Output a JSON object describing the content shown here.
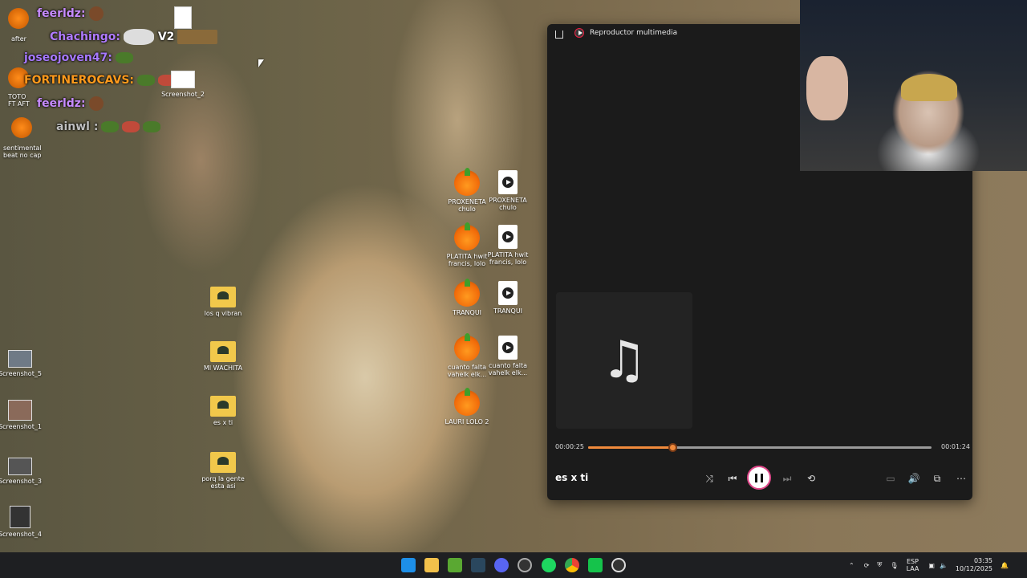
{
  "chat": [
    {
      "user": "feerldz",
      "color": "#c78bff",
      "suffix": ":"
    },
    {
      "user": "Chachingo",
      "color": "#b07bff",
      "suffix": ":",
      "extra": "V2"
    },
    {
      "user": "joseojoven47",
      "color": "#a779ff",
      "suffix": ":"
    },
    {
      "user": "FORTINEROCAVS",
      "color": "#ff9a1c",
      "suffix": ":"
    },
    {
      "user": "feerldz",
      "color": "#c78bff",
      "suffix": ":"
    },
    {
      "user": "ainwl",
      "color": "#bfbfbf",
      "suffix": ":"
    }
  ],
  "chat_side_labels": {
    "after": "after",
    "toto": "TOTO FT AFT",
    "sentimental": "sentimental beat no cap"
  },
  "left_column_icons": [
    {
      "label": "Screenshot_5"
    },
    {
      "label": "Screenshot_1"
    },
    {
      "label": "Screenshot_3"
    },
    {
      "label": "Screenshot_4"
    }
  ],
  "top_icons": [
    {
      "label": ""
    },
    {
      "label": "Screenshot_2"
    }
  ],
  "folder_icons": [
    {
      "label": "los q vibran"
    },
    {
      "label": "MI WACHITA"
    },
    {
      "label": "es x ti"
    },
    {
      "label": "porq la gente esta asi"
    }
  ],
  "project_icons": [
    {
      "fl": "PROXENETA chulo",
      "media": "PROXENETA chulo"
    },
    {
      "fl": "PLATITA hwit francis, lolo",
      "media": "PLATITA hwit francis, lolo"
    },
    {
      "fl": "TRANQUI",
      "media": "TRANQUI"
    },
    {
      "fl": "cuanto falta vahelk elk...",
      "media": "cuanto falta vahelk elk..."
    },
    {
      "fl": "LAURI LOLO 2",
      "media": null
    }
  ],
  "player": {
    "title": "Reproductor multimedia",
    "current_time": "00:00:25",
    "total_time": "00:01:24",
    "progress": 0.245,
    "track": "es x ti",
    "accent": "#f08a3c"
  },
  "taskbar": {
    "lang1": "ESP",
    "lang2": "LAA",
    "time": "03:35",
    "date": "10/12/2025"
  }
}
